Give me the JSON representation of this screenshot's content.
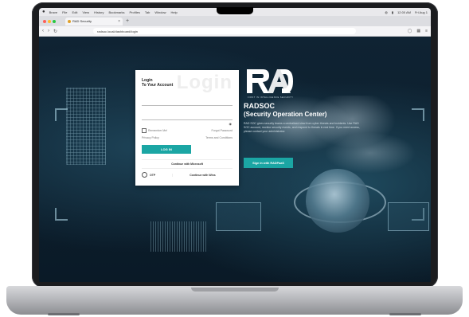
{
  "menubar": {
    "items": [
      "Brave",
      "File",
      "Edit",
      "View",
      "History",
      "Bookmarks",
      "Profiles",
      "Tab",
      "Window",
      "Help"
    ],
    "right": [
      "12:00 AM",
      "Fri Aug 1",
      "9:30 AM"
    ]
  },
  "browser": {
    "tab_title": "RAD Security",
    "url": "radsoc.local/dashboard/login"
  },
  "login": {
    "watermark": "Login",
    "title": "Login",
    "subtitle": "To Your Account",
    "username_placeholder": "",
    "password_placeholder": "",
    "remember_label": "Remember Me!",
    "forgot_label": "Forgot Password",
    "privacy_label": "Privacy Policy",
    "terms_label": "Terms and Conditions",
    "login_button": "LOG IN",
    "microsoft_button": "Continue with Microsoft",
    "otp_label": "OTP",
    "windows_button": "Continue with Wins"
  },
  "brand": {
    "logo_text": "RAD",
    "tagline": "FIRST IN INTELLIGENCE SECURITY",
    "title": "RADSOC",
    "subtitle": "(Security Operation Center)",
    "description": "RAD SOC gives security teams a centralized view from cyber threats and incidents. Use RAD SOC account, monitor security events, and respond to threats in real time. If you need access, please contact your administrator.",
    "sso_button": "Sign in with RADPaaS"
  },
  "colors": {
    "accent": "#1ba6a4"
  }
}
